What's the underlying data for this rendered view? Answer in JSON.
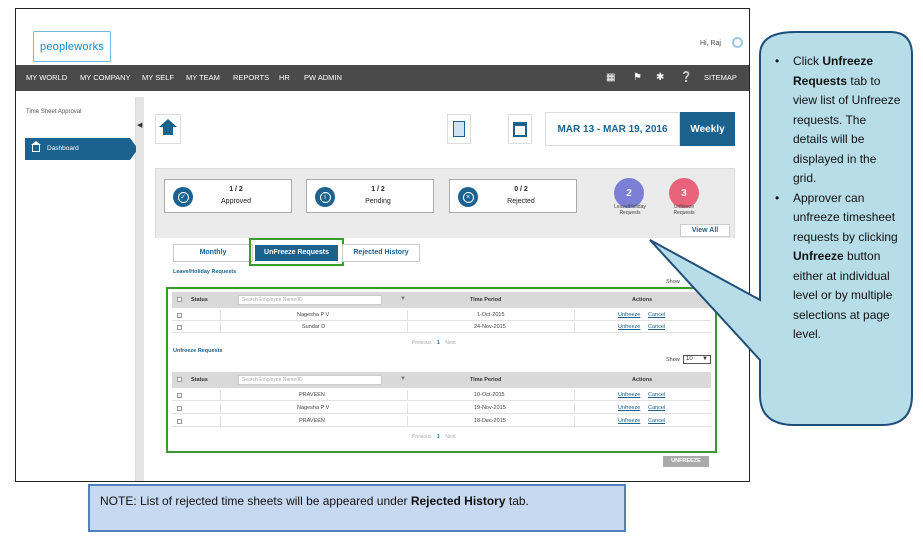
{
  "header": {
    "logo": "peopleworks",
    "greeting": "Hi, Raj"
  },
  "nav": {
    "items": [
      "MY WORLD",
      "MY COMPANY",
      "MY SELF",
      "MY TEAM",
      "REPORTS",
      "HR",
      "PW ADMIN"
    ],
    "sitemap": "SITEMAP"
  },
  "sidebar": {
    "title": "Time Sheet Approval",
    "dashboard": "Dashboard"
  },
  "toolbar": {
    "date_range": "MAR 13 - MAR 19, 2016",
    "period_mode": "Weekly"
  },
  "stats": {
    "approved": {
      "count": "1 / 2",
      "label": "Approved"
    },
    "pending": {
      "count": "1 / 2",
      "label": "Pending"
    },
    "rejected": {
      "count": "0 / 2",
      "label": "Rejected"
    },
    "leave_holiday": {
      "count": "2",
      "label_1": "Leave/Holiday",
      "label_2": "Requests",
      "color": "#7b7fd6"
    },
    "unfreeze": {
      "count": "3",
      "label_1": "Unfreeze",
      "label_2": "Requests",
      "color": "#e8637a"
    },
    "view_all": "View All"
  },
  "tabs": {
    "monthly": "Monthly",
    "unfreeze": "UnFreeze Requests",
    "rejected_history": "Rejected History"
  },
  "grid1": {
    "title": "Leave/Holiday Requests",
    "show_label": "Show",
    "columns": {
      "status": "Status",
      "search_placeholder": "Search Employee Name/ID",
      "time_period": "Time Period",
      "actions": "Actions"
    },
    "rows": [
      {
        "name": "Nagesha P V",
        "period": "1-Oct-2015",
        "unfreeze": "Unfreeze",
        "cancel": "Cancel"
      },
      {
        "name": "Sundar D",
        "period": "24-Nov-2015",
        "unfreeze": "Unfreeze",
        "cancel": "Cancel"
      }
    ],
    "pager": {
      "prev": "Previous",
      "page": "1",
      "next": "Next"
    }
  },
  "grid2": {
    "title": "Unfreeze Requests",
    "show_label": "Show",
    "show_value": "10",
    "columns": {
      "status": "Status",
      "search_placeholder": "Search Employee Name/ID",
      "time_period": "Time Period",
      "actions": "Actions"
    },
    "rows": [
      {
        "name": "PRAVEEN",
        "period": "10-Oct-2015",
        "unfreeze": "Unfreeze",
        "cancel": "Cancel"
      },
      {
        "name": "Nagesha P V",
        "period": "19-Nov-2015",
        "unfreeze": "Unfreeze",
        "cancel": "Cancel"
      },
      {
        "name": "PRAVEEN",
        "period": "18-Dec-2015",
        "unfreeze": "Unfreeze",
        "cancel": "Cancel"
      }
    ],
    "pager": {
      "prev": "Previous",
      "page": "1",
      "next": "Next"
    },
    "unfreeze_button": "UNFREEZE"
  },
  "callout": {
    "b1_pre": "Click ",
    "b1_bold": "Unfreeze Requests",
    "b1_post": " tab to view list of Unfreeze requests. The details will be displayed in the grid.",
    "b2_pre": "Approver can unfreeze timesheet requests by clicking ",
    "b2_bold": "Unfreeze",
    "b2_post": " button either at individual level or by multiple selections at page level."
  },
  "note": {
    "pre": "NOTE: List of rejected time sheets will be appeared under ",
    "bold": "Rejected History",
    "post": " tab."
  },
  "colors": {
    "brand": "#1c628f",
    "highlight": "#3a9a2e",
    "callout_fill": "#b7dde8",
    "callout_border": "#1f4e79",
    "note_fill": "#c6d9f1"
  }
}
